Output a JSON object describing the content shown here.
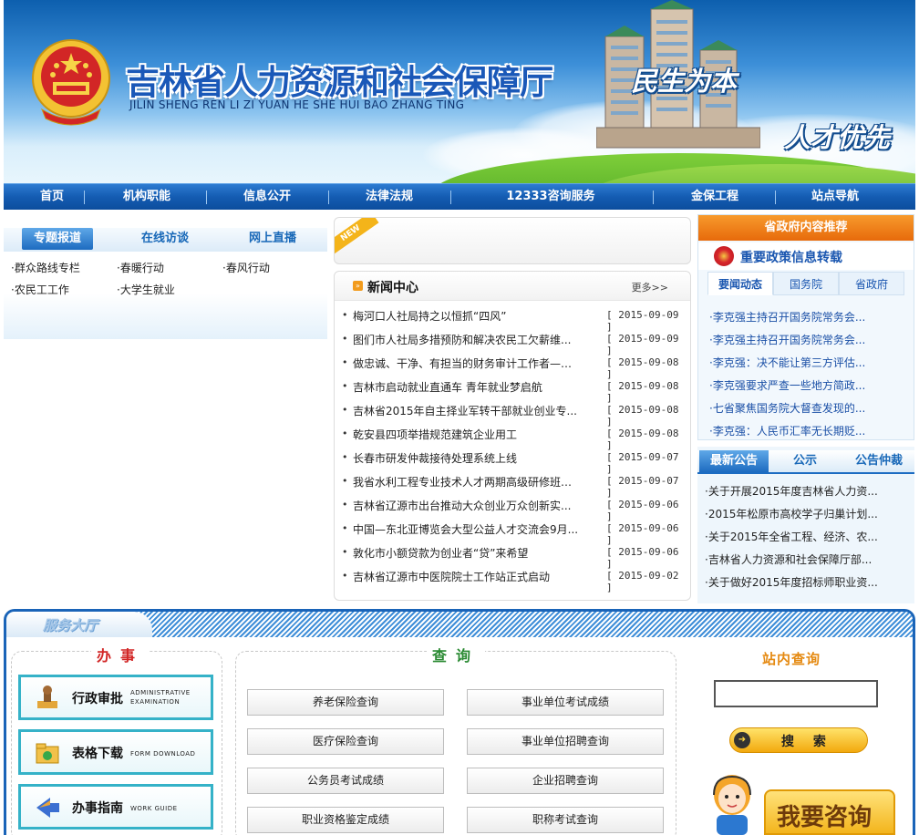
{
  "banner": {
    "title": "吉林省人力资源和社会保障厅",
    "pinyin": "JILIN SHENG REN LI ZI YUAN HE SHE HUI BAO ZHANG TING",
    "slogan1": "民生为本",
    "slogan2": "人才优先"
  },
  "nav": {
    "items": [
      "首页",
      "机构职能",
      "信息公开",
      "法律法规",
      "12333咨询服务",
      "金保工程",
      "站点导航"
    ]
  },
  "topics": {
    "tabs": [
      "专题报道",
      "在线访谈",
      "网上直播"
    ],
    "links": [
      "·群众路线专栏",
      "·春暖行动",
      "·春风行动",
      "·农民工工作",
      "·大学生就业"
    ]
  },
  "news": {
    "badge": "NEW",
    "title": "新闻中心",
    "more": "更多>>",
    "items": [
      {
        "title": "梅河口人社局持之以恒抓“四风”",
        "date": "[ 2015-09-09 ]"
      },
      {
        "title": "图们市人社局多措预防和解决农民工欠薪维...",
        "date": "[ 2015-09-09 ]"
      },
      {
        "title": "做忠诚、干净、有担当的财务审计工作者——...",
        "date": "[ 2015-09-08 ]"
      },
      {
        "title": "吉林市启动就业直通车 青年就业梦启航",
        "date": "[ 2015-09-08 ]"
      },
      {
        "title": "吉林省2015年自主择业军转干部就业创业专...",
        "date": "[ 2015-09-08 ]"
      },
      {
        "title": "乾安县四项举措规范建筑企业用工",
        "date": "[ 2015-09-08 ]"
      },
      {
        "title": "长春市研发仲裁接待处理系统上线",
        "date": "[ 2015-09-07 ]"
      },
      {
        "title": "我省水利工程专业技术人才两期高级研修班举办",
        "date": "[ 2015-09-07 ]"
      },
      {
        "title": "吉林省辽源市出台推动大众创业万众创新实...",
        "date": "[ 2015-09-06 ]"
      },
      {
        "title": "中国—东北亚博览会大型公益人才交流会9月...",
        "date": "[ 2015-09-06 ]"
      },
      {
        "title": "敦化市小额贷款为创业者“贷”来希望",
        "date": "[ 2015-09-06 ]"
      },
      {
        "title": "吉林省辽源市中医院院士工作站正式启动",
        "date": "[ 2015-09-02 ]"
      }
    ]
  },
  "recommend": {
    "header": "省政府内容推荐",
    "subtitle": "重要政策信息转载",
    "tabs": [
      "要闻动态",
      "国务院",
      "省政府"
    ],
    "items": [
      "·李克强主持召开国务院常务会...",
      "·李克强主持召开国务院常务会...",
      "·李克强：决不能让第三方评估...",
      "·李克强要求严查一些地方简政...",
      "·七省聚焦国务院大督查发现的...",
      "·李克强：人民币汇率无长期贬..."
    ]
  },
  "notice": {
    "tabs": [
      "最新公告",
      "公示",
      "公告仲裁"
    ],
    "items": [
      "·关于开展2015年度吉林省人力资...",
      "·2015年松原市高校学子归巢计划...",
      "·关于2015年全省工程、经济、农...",
      "·吉林省人力资源和社会保障厅部...",
      "·关于做好2015年度招标师职业资..."
    ]
  },
  "hall": {
    "band_title": "服务大厅",
    "affairs_title": "办事",
    "affairs": [
      {
        "cn": "行政审批",
        "en1": "ADMINISTRATIVE",
        "en2": "EXAMINATION",
        "icon": "stamp-icon"
      },
      {
        "cn": "表格下载",
        "en1": "FORM DOWNLOAD",
        "en2": "",
        "icon": "folder-icon"
      },
      {
        "cn": "办事指南",
        "en1": "WORK GUIDE",
        "en2": "",
        "icon": "guide-arrow-icon"
      }
    ],
    "query_title": "查询",
    "queries": [
      "养老保险查询",
      "事业单位考试成绩",
      "医疗保险查询",
      "事业单位招聘查询",
      "公务员考试成绩",
      "企业招聘查询",
      "职业资格鉴定成绩",
      "职称考试查询"
    ],
    "site_search_title": "站内查询",
    "search_label": "搜 索",
    "consult_label": "我要咨询"
  },
  "colors": {
    "nav_blue": "#145cb2",
    "accent_orange": "#e76a0b",
    "link_blue": "#1a56b0",
    "service_teal": "#35b2c8"
  }
}
